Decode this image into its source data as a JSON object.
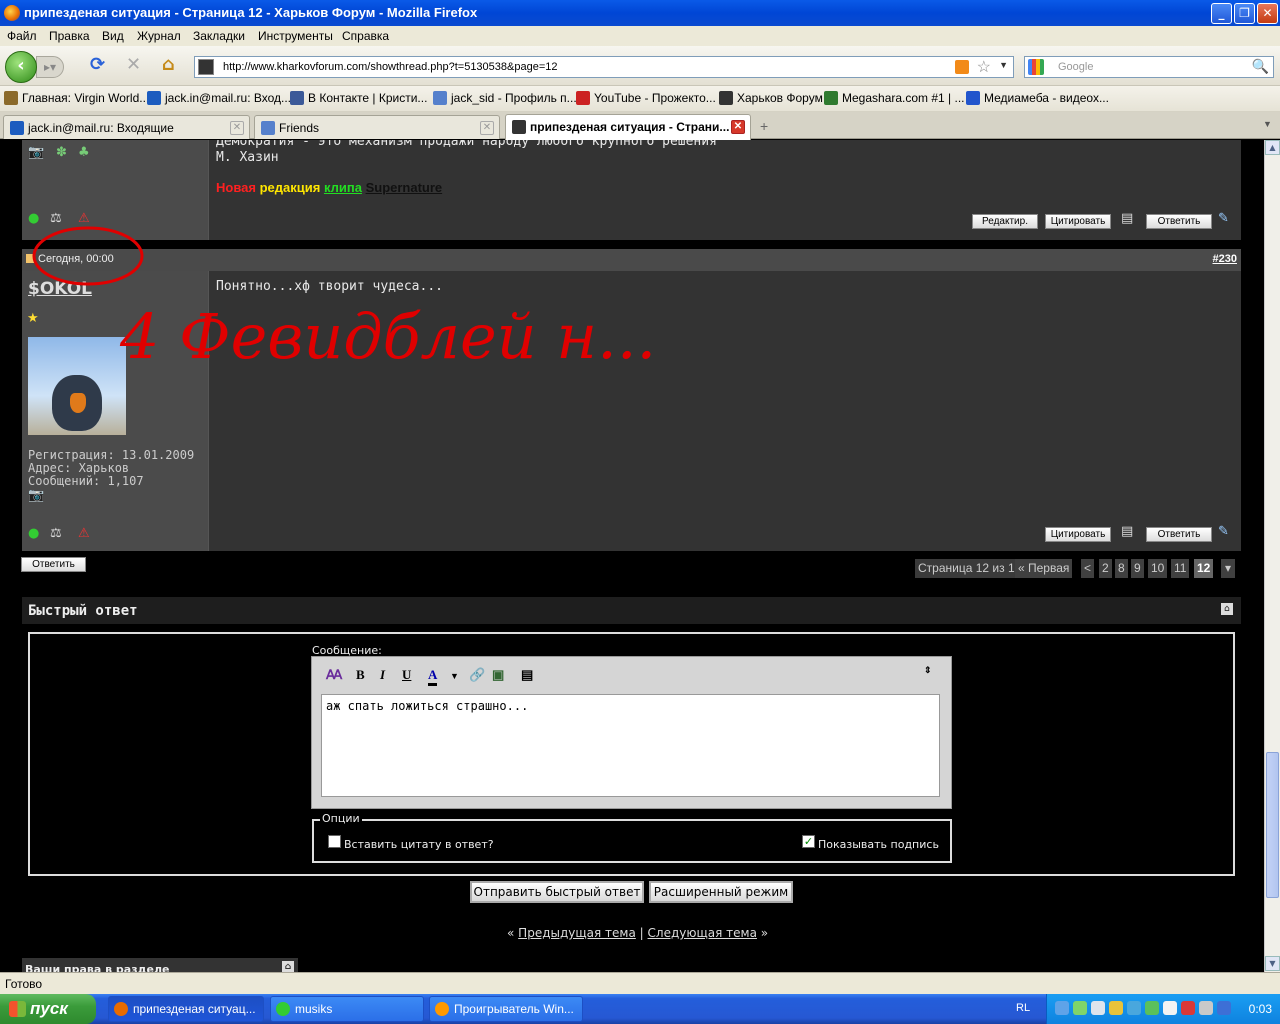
{
  "window": {
    "title": "припезденая ситуация - Страница 12 - Харьков Форум - Mozilla Firefox"
  },
  "menu": [
    "Файл",
    "Правка",
    "Вид",
    "Журнал",
    "Закладки",
    "Инструменты",
    "Справка"
  ],
  "nav": {
    "url": "http://www.kharkovforum.com/showthread.php?t=5130538&page=12",
    "search_placeholder": "Google"
  },
  "bookmarks": [
    {
      "label": "Главная: Virgin World...",
      "color": "#8b6a2b"
    },
    {
      "label": "jack.in@mail.ru: Вход...",
      "color": "#1c5cbf"
    },
    {
      "label": "В Контакте | Кристи...",
      "color": "#3b5998"
    },
    {
      "label": "jack_sid - Профиль п...",
      "color": "#5580cc"
    },
    {
      "label": "YouTube - Прожекто...",
      "color": "#cc2222"
    },
    {
      "label": "Харьков Форум",
      "color": "#333333"
    },
    {
      "label": "Megashara.com #1 | ...",
      "color": "#2f7a2f"
    },
    {
      "label": "Медиамеба - видеох...",
      "color": "#2255cc"
    }
  ],
  "tabs": [
    {
      "label": "jack.in@mail.ru: Входящие"
    },
    {
      "label": "Friends"
    },
    {
      "label": "припезденая ситуация - Страни..."
    }
  ],
  "post1": {
    "text": "Демократия - это механизм продажи народу любого крупного решения",
    "author_line": "М. Хазин",
    "sig": [
      "Новая",
      "редакция",
      "клипа",
      "Supernature"
    ],
    "sig_colors": [
      "#ff2020",
      "#ffe600",
      "#22dd22",
      "#111111"
    ],
    "buttons": {
      "edit": "Редактир.",
      "quote": "Цитировать",
      "reply": "Ответить"
    }
  },
  "post2": {
    "date": "Сегодня, 00:00",
    "number": "#230",
    "username": "$OKOL",
    "text": "Понятно...хф творит чудеса...",
    "profile": [
      "Регистрация: 13.01.2009",
      "Адрес: Харьков",
      "Сообщений: 1,107"
    ],
    "buttons": {
      "quote": "Цитировать",
      "reply": "Ответить"
    },
    "annotation": "4 Февидблей н..."
  },
  "reply_button": "Ответить",
  "pager": {
    "label": "Страница 12 из 12",
    "first": "« Первая",
    "prev": "<",
    "pages": [
      "2",
      "8",
      "9",
      "10",
      "11",
      "12"
    ],
    "current": "12"
  },
  "quick_reply": {
    "title": "Быстрый ответ",
    "message_label": "Сообщение:",
    "toolbar": [
      "B",
      "I",
      "U",
      "A"
    ],
    "text": "аж спать ложиться страшно...",
    "options_legend": "Опции",
    "opt_quote": "Вставить цитату в ответ?",
    "opt_sig": "Показывать подпись",
    "opt_quote_checked": false,
    "opt_sig_checked": true,
    "submit": "Отправить быстрый ответ",
    "advanced": "Расширенный режим"
  },
  "thread_nav": {
    "prev": "Предыдущая тема",
    "next": "Следующая тема"
  },
  "rights_header": "Ваши права в разделе",
  "status": "Готово",
  "taskbar": {
    "start": "пуск",
    "tasks": [
      "припезденая ситуац...",
      "musiks",
      "Проигрыватель Win..."
    ],
    "lang": "RL",
    "clock": "0:03"
  }
}
